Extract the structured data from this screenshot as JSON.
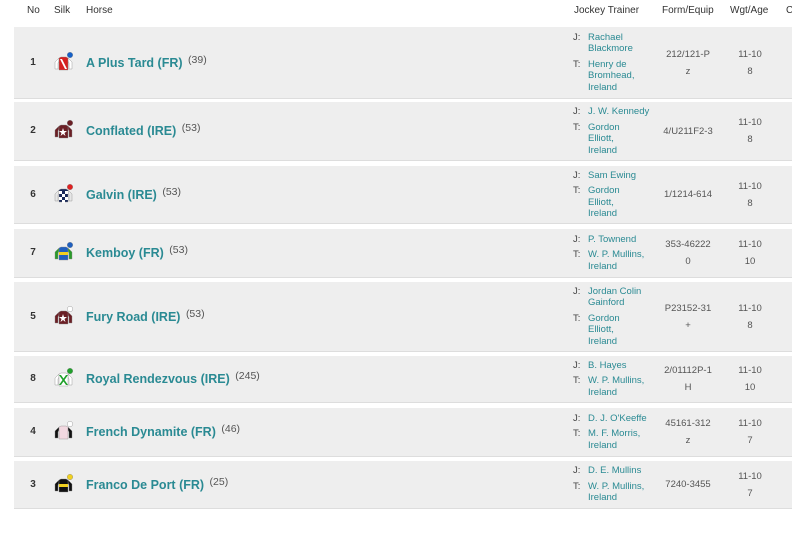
{
  "headers": {
    "no": "No",
    "silk": "Silk",
    "horse": "Horse",
    "jockey_trainer": "Jockey Trainer",
    "form_equip": "Form/Equip",
    "wgt_age": "Wgt/Age",
    "extra": "C"
  },
  "labels": {
    "jockey": "J:",
    "trainer": "T:"
  },
  "rows": [
    {
      "no": "1",
      "horse": "A Plus Tard (FR)",
      "rating": "(39)",
      "jockey": [
        "Rachael",
        "Blackmore"
      ],
      "trainer": [
        "Henry de",
        "Bromhead,",
        "Ireland"
      ],
      "form": [
        "212/121-P",
        "z"
      ],
      "wgt": [
        "11-10",
        "8"
      ],
      "silk": {
        "body": "#d62020",
        "sleeve": "#ffffff",
        "cap": "#1560c8",
        "pattern": "sash-white"
      }
    },
    {
      "no": "2",
      "horse": "Conflated (IRE)",
      "rating": "(53)",
      "jockey": [
        "J. W. Kennedy"
      ],
      "trainer": [
        "Gordon",
        "Elliott,",
        "Ireland"
      ],
      "form": [
        "4/U211F2-3"
      ],
      "wgt": [
        "11-10",
        "8"
      ],
      "silk": {
        "body": "#6b1f25",
        "sleeve": "#6b1f25",
        "cap": "#6b1f25",
        "pattern": "star"
      }
    },
    {
      "no": "6",
      "horse": "Galvin (IRE)",
      "rating": "(53)",
      "jockey": [
        "Sam Ewing"
      ],
      "trainer": [
        "Gordon",
        "Elliott,",
        "Ireland"
      ],
      "form": [
        "1/1214-614"
      ],
      "wgt": [
        "11-10",
        "8"
      ],
      "silk": {
        "body": "#1a2a5a",
        "sleeve": "#e6e6e6",
        "cap": "#e02020",
        "pattern": "check"
      }
    },
    {
      "no": "7",
      "horse": "Kemboy (FR)",
      "rating": "(53)",
      "jockey": [
        "P. Townend"
      ],
      "trainer": [
        "W. P. Mullins,",
        "Ireland"
      ],
      "form": [
        "353-46222",
        "0"
      ],
      "wgt": [
        "11-10",
        "10"
      ],
      "silk": {
        "body": "#1e5fbf",
        "sleeve": "#2a9a2a",
        "cap": "#1e5fbf",
        "pattern": "hoop-yellow"
      }
    },
    {
      "no": "5",
      "horse": "Fury Road (IRE)",
      "rating": "(53)",
      "jockey": [
        "Jordan Colin",
        "Gainford"
      ],
      "trainer": [
        "Gordon",
        "Elliott,",
        "Ireland"
      ],
      "form": [
        "P23152-31",
        "+"
      ],
      "wgt": [
        "11-10",
        "8"
      ],
      "silk": {
        "body": "#6b1f25",
        "sleeve": "#6b1f25",
        "cap": "#ffffff",
        "pattern": "star"
      }
    },
    {
      "no": "8",
      "horse": "Royal Rendezvous (IRE)",
      "rating": "(245)",
      "jockey": [
        "B. Hayes"
      ],
      "trainer": [
        "W. P. Mullins,",
        "Ireland"
      ],
      "form": [
        "2/01112P-1",
        "H"
      ],
      "wgt": [
        "11-10",
        "10"
      ],
      "silk": {
        "body": "#ffffff",
        "sleeve": "#ffffff",
        "cap": "#1fa02a",
        "pattern": "cross-green"
      }
    },
    {
      "no": "4",
      "horse": "French Dynamite (FR)",
      "rating": "(46)",
      "jockey": [
        "D. J. O'Keeffe"
      ],
      "trainer": [
        "M. F. Morris,",
        "Ireland"
      ],
      "form": [
        "45161-312",
        "z"
      ],
      "wgt": [
        "11-10",
        "7"
      ],
      "silk": {
        "body": "#f2d8e0",
        "sleeve": "#111111",
        "cap": "#ffffff",
        "pattern": "plain"
      }
    },
    {
      "no": "3",
      "horse": "Franco De Port (FR)",
      "rating": "(25)",
      "jockey": [
        "D. E. Mullins"
      ],
      "trainer": [
        "W. P. Mullins,",
        "Ireland"
      ],
      "form": [
        "7240-3455"
      ],
      "wgt": [
        "11-10",
        "7"
      ],
      "silk": {
        "body": "#111111",
        "sleeve": "#111111",
        "cap": "#f0d020",
        "pattern": "hoop-yellow"
      }
    }
  ]
}
